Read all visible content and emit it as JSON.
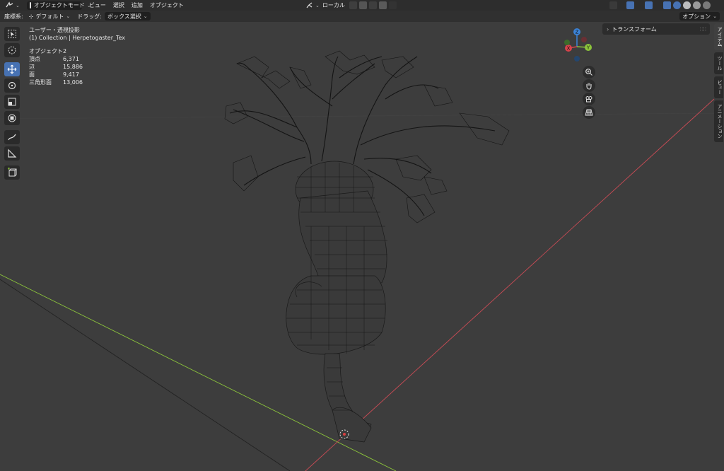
{
  "header": {
    "editor_icon": "dropdown-icon",
    "mode": "オブジェクトモード",
    "menus": [
      "ビュー",
      "選択",
      "追加",
      "オブジェクト"
    ],
    "transform_orientation": "ローカル"
  },
  "toolbar_header": {
    "coord_label": "座標系:",
    "coord_value": "デフォルト",
    "drag_label": "ドラッグ:",
    "drag_value": "ボックス選択",
    "options": "オプション"
  },
  "overlay": {
    "view_name": "ユーザー・透視投影",
    "collection": "(1) Collection | Herpetogaster_Tex",
    "stats": [
      {
        "label": "オブジェクト",
        "value": "2"
      },
      {
        "label": "頂点",
        "value": "6,371"
      },
      {
        "label": "辺",
        "value": "15,886"
      },
      {
        "label": "面",
        "value": "9,417"
      },
      {
        "label": "三角形面",
        "value": "13,006"
      }
    ]
  },
  "gizmo": {
    "x": "X",
    "y": "Y",
    "z": "Z"
  },
  "side_panel": {
    "transform_title": "トランスフォーム",
    "tabs": [
      "アイテム",
      "ツール",
      "ビュー",
      "アニメーション"
    ]
  },
  "tools": [
    "select-box-icon",
    "cursor-icon",
    "move-icon",
    "rotate-icon",
    "scale-icon",
    "transform-icon",
    "annotate-icon",
    "measure-icon",
    "add-cube-icon"
  ],
  "colors": {
    "accent": "#4772b3",
    "axis_x": "#d8434b",
    "axis_y": "#8cc43b",
    "axis_z": "#3b83d8"
  }
}
